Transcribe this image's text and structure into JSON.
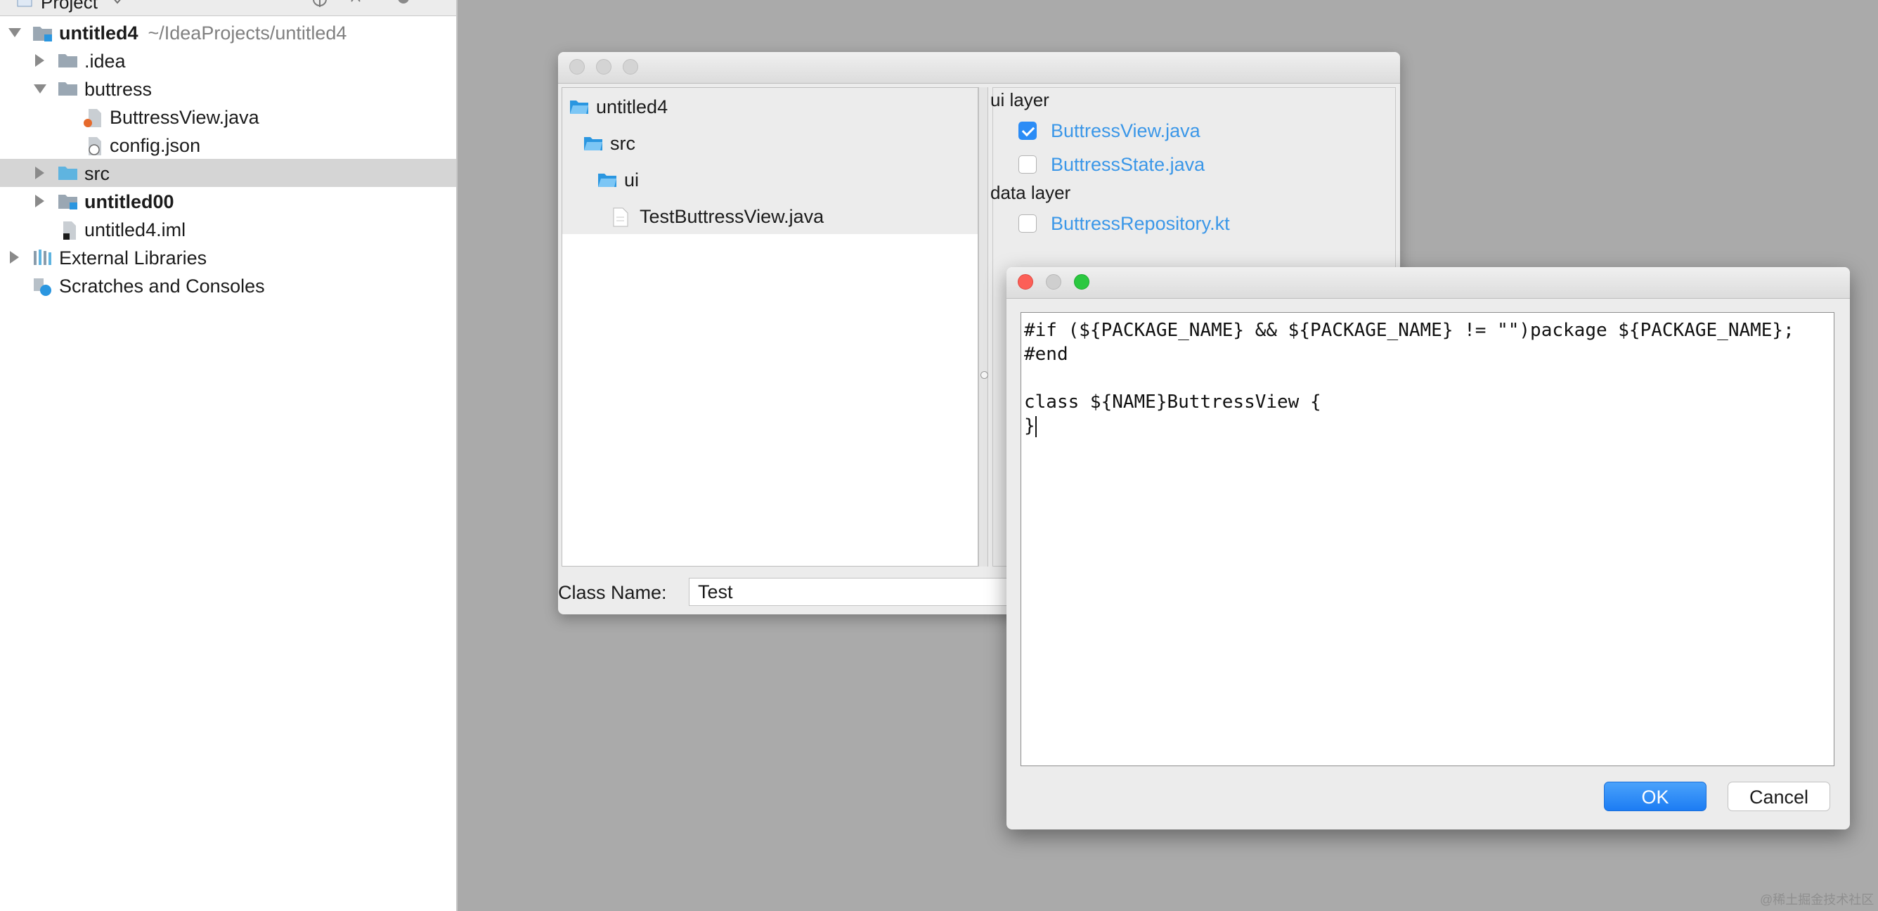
{
  "project_panel": {
    "header_label": "Project",
    "tree": [
      {
        "label": "untitled4",
        "hint": "~/IdeaProjects/untitled4"
      },
      {
        "label": ".idea"
      },
      {
        "label": "buttress"
      },
      {
        "label": "ButtressView.java"
      },
      {
        "label": "config.json"
      },
      {
        "label": "src",
        "selected": true
      },
      {
        "label": "untitled00"
      },
      {
        "label": "untitled4.iml"
      },
      {
        "label": "External Libraries"
      },
      {
        "label": "Scratches and Consoles"
      }
    ]
  },
  "template_dialog": {
    "directory_tree": [
      "untitled4",
      "src",
      "ui",
      "TestButtressView.java"
    ],
    "sections": [
      {
        "title": "ui layer",
        "options": [
          {
            "label": "ButtressView.java",
            "checked": true
          },
          {
            "label": "ButtressState.java",
            "checked": false
          }
        ]
      },
      {
        "title": "data layer",
        "options": [
          {
            "label": "ButtressRepository.kt",
            "checked": false
          }
        ]
      }
    ],
    "class_name_label": "Class Name:",
    "class_name_value": "Test"
  },
  "editor_dialog": {
    "code_lines": [
      "#if (${PACKAGE_NAME} && ${PACKAGE_NAME} != \"\")package ${PACKAGE_NAME};",
      "#end",
      "",
      "class ${NAME}ButtressView {",
      "}"
    ],
    "ok_label": "OK",
    "cancel_label": "Cancel"
  },
  "watermark": "@稀土掘金技术社区",
  "colors": {
    "accent": "#1c7cf3",
    "folder_blue": "#2a96e0",
    "link_blue": "#3b97e8",
    "desktop_gray": "#aaaaaa"
  }
}
